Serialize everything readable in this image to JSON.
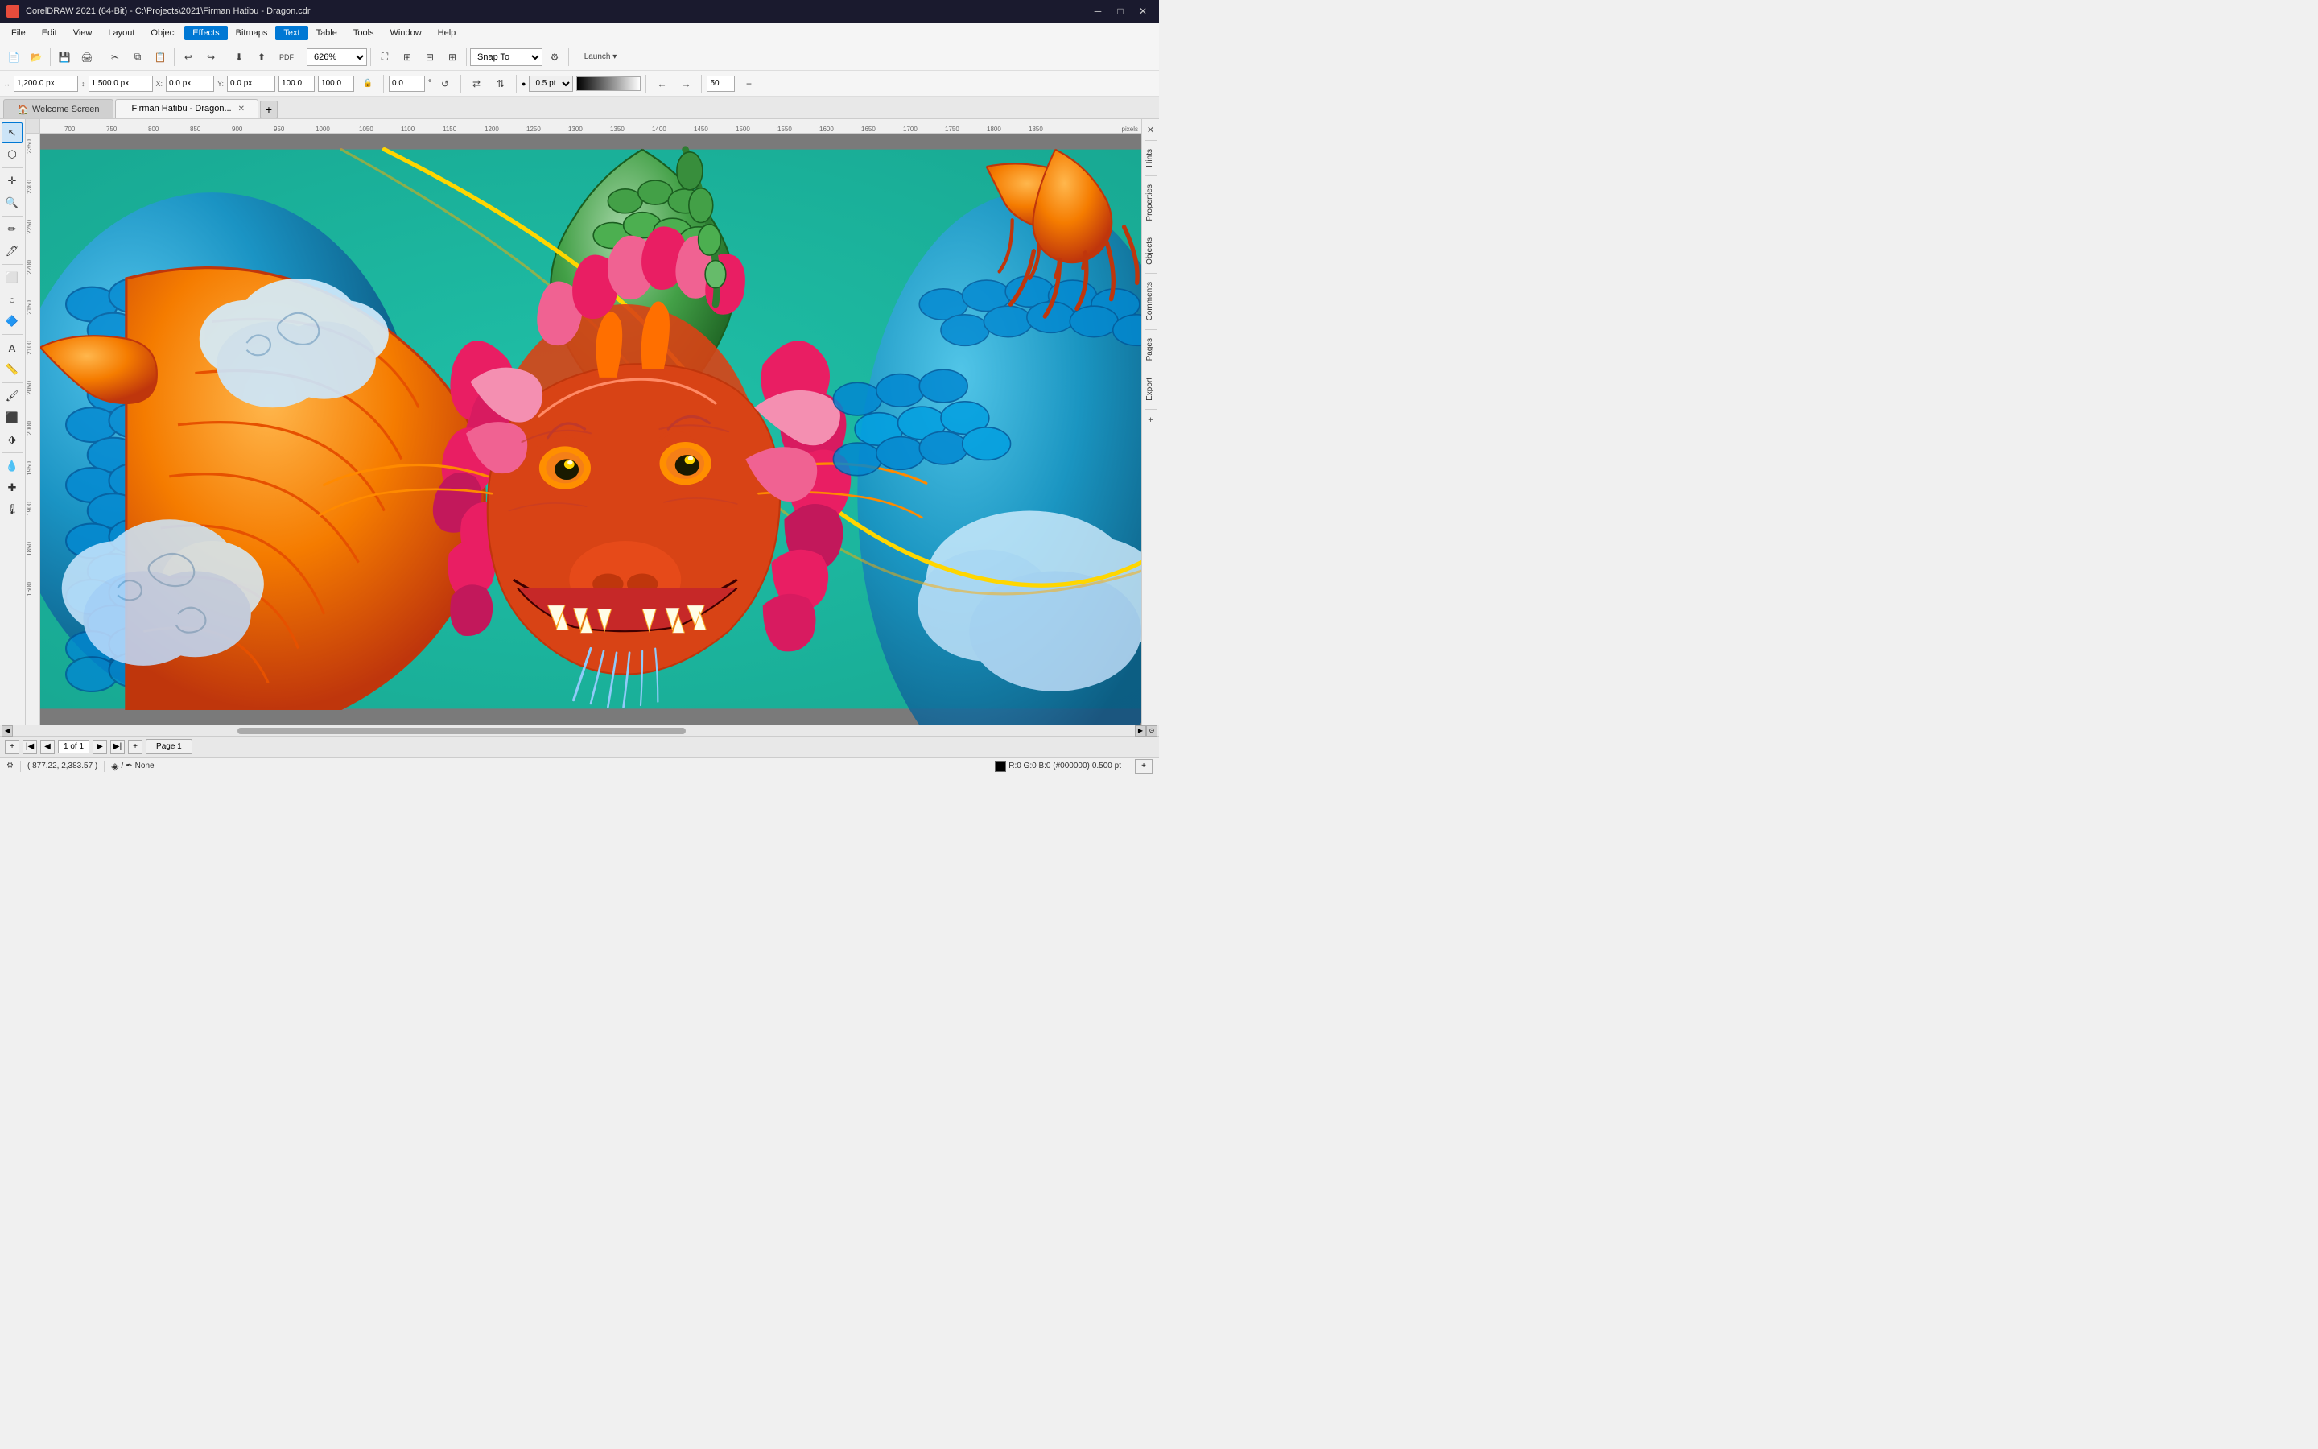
{
  "titlebar": {
    "title": "CorelDRAW 2021 (64-Bit) - C:\\Projects\\2021\\Firman Hatibu - Dragon.cdr",
    "app_name": "CorelDRAW 2021 (64-Bit)",
    "file_path": "C:\\Projects\\2021\\Firman Hatibu - Dragon.cdr",
    "minimize_label": "─",
    "maximize_label": "□",
    "close_label": "✕"
  },
  "menubar": {
    "items": [
      "File",
      "Edit",
      "View",
      "Layout",
      "Object",
      "Effects",
      "Bitmaps",
      "Text",
      "Table",
      "Tools",
      "Window",
      "Help"
    ]
  },
  "toolbar": {
    "zoom_level": "626%",
    "snap_to": "Snap To",
    "launch": "Launch"
  },
  "propbar": {
    "width": "1,200.0 px",
    "height": "1,500.0 px",
    "x": "0.0 px",
    "y": "0.0 px",
    "w2": "100.0",
    "h2": "100.0",
    "stroke_width": "0.5 pt",
    "angle": "0.0",
    "opacity": "50"
  },
  "tabs": [
    {
      "id": "welcome",
      "label": "Welcome Screen",
      "icon": "🏠",
      "closable": false
    },
    {
      "id": "dragon",
      "label": "Firman Hatibu - Dragon...",
      "icon": "",
      "closable": true
    }
  ],
  "tools": {
    "items": [
      "↖",
      "⬡",
      "✚",
      "🔍",
      "⚡",
      "🖊",
      "⬜",
      "○",
      "🔷",
      "A",
      "📏",
      "🖌",
      "⬛",
      "⬗",
      "💧",
      "✚",
      "🌡"
    ]
  },
  "right_panel": {
    "tabs": [
      "Hints",
      "Properties",
      "Objects",
      "Comments",
      "Pages",
      "Export"
    ]
  },
  "status_bar": {
    "coordinates": "( 877.22, 2,383.57 )",
    "fill_indicator": "None",
    "color_info": "R:0 G:0 B:0 (#000000)",
    "stroke": "0.500 pt"
  },
  "page_bar": {
    "current": "1 of 1",
    "page_name": "Page 1"
  },
  "ruler": {
    "top_marks": [
      "700",
      "750",
      "800",
      "850",
      "900",
      "950",
      "1000",
      "1050",
      "1100",
      "1150",
      "1200",
      "1250",
      "1300",
      "1350",
      "1400",
      "1450",
      "1500",
      "1550",
      "1600",
      "1650",
      "1700",
      "1750",
      "1800",
      "1850"
    ],
    "left_marks": [
      "2350",
      "2300",
      "2250",
      "2200",
      "2150",
      "2100",
      "2050",
      "2000",
      "1950",
      "1900",
      "1850",
      "1600"
    ],
    "units": "pixels"
  },
  "canvas": {
    "background_color": "#7a7a7a",
    "zoom": 626
  }
}
